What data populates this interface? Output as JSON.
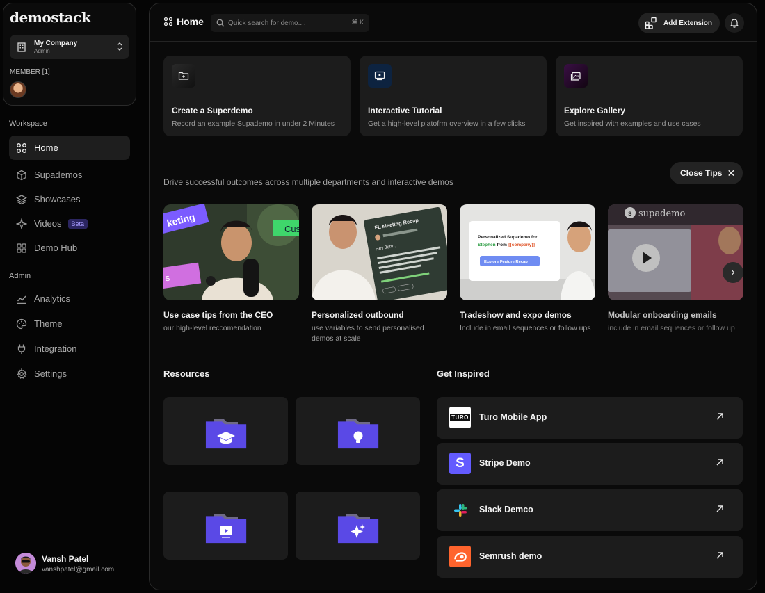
{
  "app": {
    "logo": "demostack"
  },
  "workspace_switcher": {
    "name": "My Company",
    "role": "Admin"
  },
  "members": {
    "label": "MEMBER [1]"
  },
  "nav": {
    "workspace_label": "Workspace",
    "items": [
      {
        "label": "Home",
        "icon": "grid-icon",
        "active": true
      },
      {
        "label": "Supademos",
        "icon": "cube-icon"
      },
      {
        "label": "Showcases",
        "icon": "layers-icon"
      },
      {
        "label": "Videos",
        "icon": "sparkle-icon",
        "badge": "Beta"
      },
      {
        "label": "Demo Hub",
        "icon": "apps-icon"
      }
    ],
    "admin_label": "Admin",
    "admin_items": [
      {
        "label": "Analytics",
        "icon": "chart-icon"
      },
      {
        "label": "Theme",
        "icon": "palette-icon"
      },
      {
        "label": "Integration",
        "icon": "plug-icon"
      },
      {
        "label": "Settings",
        "icon": "gear-icon"
      }
    ]
  },
  "user": {
    "name": "Vansh Patel",
    "email": "vanshpatel@gmail.com"
  },
  "topbar": {
    "title": "Home",
    "search_placeholder": "Quick search for demo....",
    "search_shortcut": "⌘ K",
    "extension_button": "Add Extension"
  },
  "quick_actions": [
    {
      "title": "Create a Superdemo",
      "desc": "Record an example Supademo in under 2 Minutes",
      "icon": "folder-plus-icon",
      "color": "#1a1a1a"
    },
    {
      "title": "Interactive Tutorial",
      "desc": "Get a high-level platofrm overview in a few clicks",
      "icon": "play-screen-icon",
      "color": "#0d2340"
    },
    {
      "title": "Explore Gallery",
      "desc": "Get inspired with examples and use cases",
      "icon": "gallery-icon",
      "color": "#2a0f33"
    }
  ],
  "tips": {
    "subtitle": "Drive successful outcomes across multiple departments and interactive demos",
    "close_label": "Close Tips",
    "items": [
      {
        "title": "Use case tips from the CEO",
        "desc": "our high-level reccomendation"
      },
      {
        "title": "Personalized outbound",
        "desc": "use variables to send personalised demos at scale",
        "card_title": "FL Meeting Recap",
        "card_greeting": "Hey John,"
      },
      {
        "title": "Tradeshow and expo demos",
        "desc": "Include in email sequences or follow ups",
        "card_text": "Personalized Supademo for",
        "card_name": "Stephen",
        "card_from": "from",
        "card_var": "{{company}}",
        "card_button": "Explore Feature Recap"
      },
      {
        "title": "Modular onboarding emails",
        "desc": "include in email sequences or follow up",
        "brand": "supademo"
      }
    ],
    "thumb_words": {
      "marketing": "keting",
      "customer": "Cus",
      "sales": "s"
    }
  },
  "resources": {
    "heading": "Resources",
    "items": [
      {
        "icon": "graduation-cap-icon"
      },
      {
        "icon": "lightbulb-icon"
      },
      {
        "icon": "video-icon"
      },
      {
        "icon": "sparkle-icon"
      }
    ]
  },
  "inspired": {
    "heading": "Get Inspired",
    "items": [
      {
        "name": "Turo Mobile App",
        "logo": "TURO"
      },
      {
        "name": "Stripe Demo",
        "logo": "S"
      },
      {
        "name": "Slack Demco",
        "logo": "slack-logo-icon"
      },
      {
        "name": "Semrush demo",
        "logo": "semrush-logo-icon"
      }
    ]
  },
  "colors": {
    "accent": "#5b4cf0",
    "folder": "#5a49e6"
  }
}
